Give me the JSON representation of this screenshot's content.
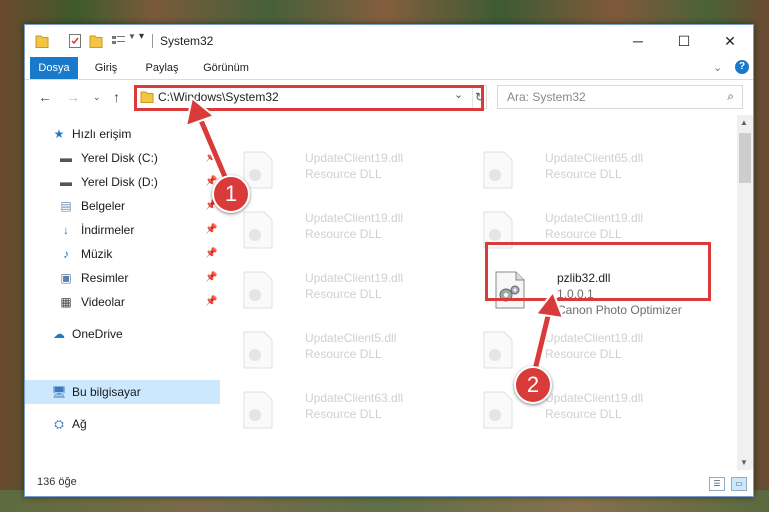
{
  "window": {
    "title": "System32"
  },
  "ribbon": {
    "tabs": [
      "Dosya",
      "Giriş",
      "Paylaş",
      "Görünüm"
    ]
  },
  "address": {
    "path": "C:\\Windows\\System32"
  },
  "search": {
    "placeholder": "Ara: System32"
  },
  "sidebar": {
    "items": [
      {
        "label": "Hızlı erişim",
        "icon": "star-icon"
      },
      {
        "label": "Yerel Disk (C:)",
        "icon": "drive-icon"
      },
      {
        "label": "Yerel Disk (D:)",
        "icon": "drive-icon"
      },
      {
        "label": "Belgeler",
        "icon": "documents-icon"
      },
      {
        "label": "İndirmeler",
        "icon": "download-icon"
      },
      {
        "label": "Müzik",
        "icon": "music-icon"
      },
      {
        "label": "Resimler",
        "icon": "pictures-icon"
      },
      {
        "label": "Videolar",
        "icon": "video-icon"
      },
      {
        "label": "OneDrive",
        "icon": "cloud-icon"
      },
      {
        "label": "Bu bilgisayar",
        "icon": "computer-icon"
      },
      {
        "label": "Ağ",
        "icon": "network-icon"
      }
    ]
  },
  "files": [
    {
      "name": "UpdateClient19.dll",
      "type": "Resource DLL"
    },
    {
      "name": "UpdateClient65.dll",
      "type": "Resource DLL"
    },
    {
      "name": "UpdateClient19.dll",
      "type": "Resource DLL"
    },
    {
      "name": "UpdateClient19.dll",
      "type": "Resource DLL"
    },
    {
      "name": "UpdateClient19.dll",
      "type": "Resource DLL"
    },
    {
      "name": "pzlib32.dll",
      "version": "1.0.0.1",
      "description": "Canon Photo Optimizer"
    },
    {
      "name": "UpdateClient5.dll",
      "type": "Resource DLL"
    },
    {
      "name": "UpdateClient19.dll",
      "type": "Resource DLL"
    },
    {
      "name": "UpdateClient63.dll",
      "type": "Resource DLL"
    },
    {
      "name": "UpdateClient19.dll",
      "type": "Resource DLL"
    }
  ],
  "status": {
    "count": "136 öğe"
  },
  "annotations": {
    "step1": "1",
    "step2": "2"
  },
  "colors": {
    "accent": "#1979ca",
    "highlight": "#d93a3a",
    "selected": "#cce8ff"
  }
}
